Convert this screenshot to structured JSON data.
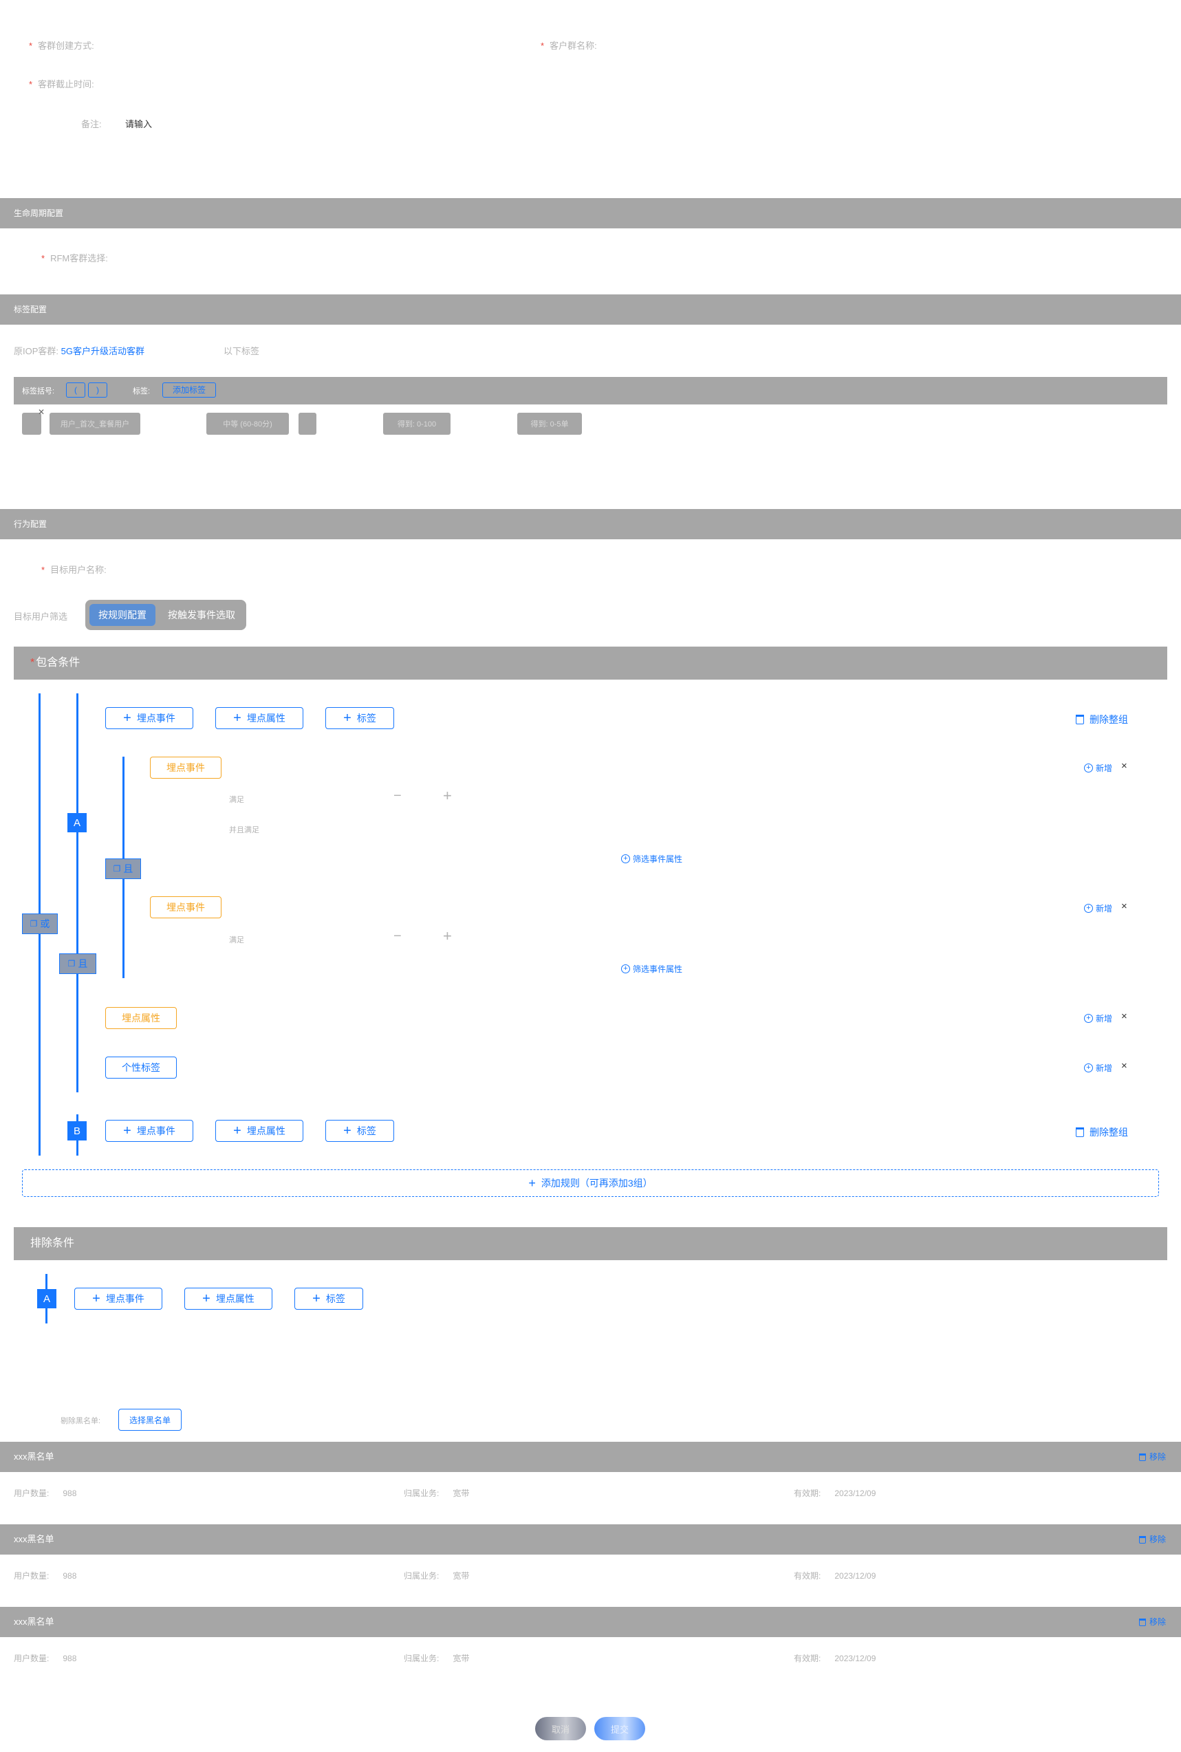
{
  "basic": {
    "create_method_label": "客群创建方式:",
    "group_name_label": "客户群名称:",
    "deadline_label": "客群截止时间:",
    "remark_label": "备注:",
    "remark_placeholder": "请输入"
  },
  "lifecycle": {
    "section_title": "生命周期配置",
    "rfm_label": "RFM客群选择:"
  },
  "tags_config": {
    "section_title": "标签配置",
    "source_label": "原IOP客群:",
    "source_value": "5G客户升级活动客群",
    "following_tags": "以下标签",
    "bracket_label": "标签括号:",
    "open_bracket": "(",
    "close_bracket": ")",
    "tag_label": "标签:",
    "add_tag_button": "添加标签",
    "tag_boxes": [
      "用户_首次_套餐用户",
      "中等 (60-80分)",
      "得到: 0-100",
      "得到: 0-5单"
    ]
  },
  "behavior": {
    "section_title": "行为配置",
    "target_name_label": "目标用户名称:",
    "target_filter_label": "目标用户筛选",
    "mode_tabs": [
      "按规则配置",
      "按触发事件选取"
    ],
    "include_title": "包含条件",
    "exclude_title": "排除条件",
    "add_event": "埋点事件",
    "add_attr": "埋点属性",
    "add_tag": "标签",
    "delete_group": "删除整组",
    "group_a": "A",
    "group_b": "B",
    "or_label": "或",
    "and_label": "且",
    "event_tag": "埋点事件",
    "attr_tag": "埋点属性",
    "personal_tag": "个性标签",
    "satisfy": "满足",
    "and_satisfy": "并且满足",
    "minus": "−",
    "plus": "+",
    "filter_event_attr": "筛选事件属性",
    "new": "新增",
    "close": "×",
    "add_rule": "添加规则（可再添加3组）"
  },
  "blacklist": {
    "remove_label": "剔除黑名单:",
    "select_button": "选择黑名单",
    "items": [
      {
        "name": "xxx黑名单",
        "remove": "移除",
        "count_label": "用户数量:",
        "count": "988",
        "biz_label": "归属业务:",
        "biz": "宽带",
        "expire_label": "有效期:",
        "expire": "2023/12/09"
      },
      {
        "name": "xxx黑名单",
        "remove": "移除",
        "count_label": "用户数量:",
        "count": "988",
        "biz_label": "归属业务:",
        "biz": "宽带",
        "expire_label": "有效期:",
        "expire": "2023/12/09"
      },
      {
        "name": "xxx黑名单",
        "remove": "移除",
        "count_label": "用户数量:",
        "count": "988",
        "biz_label": "归属业务:",
        "biz": "宽带",
        "expire_label": "有效期:",
        "expire": "2023/12/09"
      }
    ]
  },
  "footer": {
    "cancel": "取消",
    "submit": "提交"
  },
  "colors": {
    "primary": "#1677ff",
    "orange": "#f5a623",
    "section_bar": "#a6a6a6",
    "required_star": "#e8453c"
  }
}
